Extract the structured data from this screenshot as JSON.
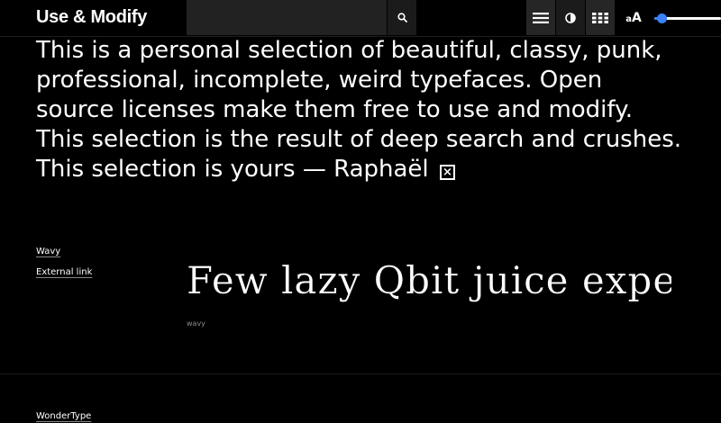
{
  "header": {
    "logo": "Use & Modify",
    "search": {
      "placeholder": "",
      "value": ""
    },
    "search_icon": "search-icon",
    "tools": [
      {
        "name": "list-view",
        "icon": "hamburger-icon"
      },
      {
        "name": "contrast",
        "icon": "contrast-icon"
      },
      {
        "name": "grid-view",
        "icon": "grid-icon"
      }
    ],
    "size_label_small": "a",
    "size_label_big": "A",
    "size_slider": {
      "value_percent": 12,
      "accent": "#3b82f6"
    }
  },
  "intro": {
    "text": "This is a personal selection of beautiful, classy, punk, professional, incomplete, weird typefaces. Open source licenses make them free to use and modify. This selection is the result of deep search and crushes. This selection is yours — Raphaël",
    "close_glyph": "×"
  },
  "fonts": [
    {
      "name": "Wavy",
      "link_label": "External link",
      "specimen": "Few lazy Qbit juice experts",
      "caption": "wavy"
    },
    {
      "name": "WonderType"
    }
  ],
  "colors": {
    "background": "#000000",
    "text": "#ffffff",
    "accent": "#3b82f6"
  }
}
